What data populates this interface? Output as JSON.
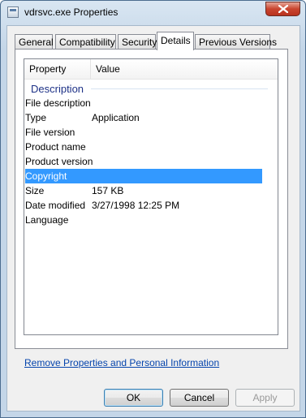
{
  "window": {
    "title": "vdrsvc.exe Properties"
  },
  "tabs": [
    {
      "label": "General"
    },
    {
      "label": "Compatibility"
    },
    {
      "label": "Security"
    },
    {
      "label": "Details"
    },
    {
      "label": "Previous Versions"
    }
  ],
  "active_tab": "Details",
  "details": {
    "columns": {
      "property": "Property",
      "value": "Value"
    },
    "group": "Description",
    "rows": [
      {
        "property": "File description",
        "value": ""
      },
      {
        "property": "Type",
        "value": "Application"
      },
      {
        "property": "File version",
        "value": ""
      },
      {
        "property": "Product name",
        "value": ""
      },
      {
        "property": "Product version",
        "value": ""
      },
      {
        "property": "Copyright",
        "value": "",
        "selected": true
      },
      {
        "property": "Size",
        "value": "157 KB"
      },
      {
        "property": "Date modified",
        "value": "3/27/1998 12:25 PM"
      },
      {
        "property": "Language",
        "value": ""
      }
    ]
  },
  "link": "Remove Properties and Personal Information",
  "buttons": {
    "ok": "OK",
    "cancel": "Cancel",
    "apply": "Apply"
  },
  "colors": {
    "selection": "#3399ff",
    "group_title": "#1e3287",
    "link": "#0645ad"
  }
}
